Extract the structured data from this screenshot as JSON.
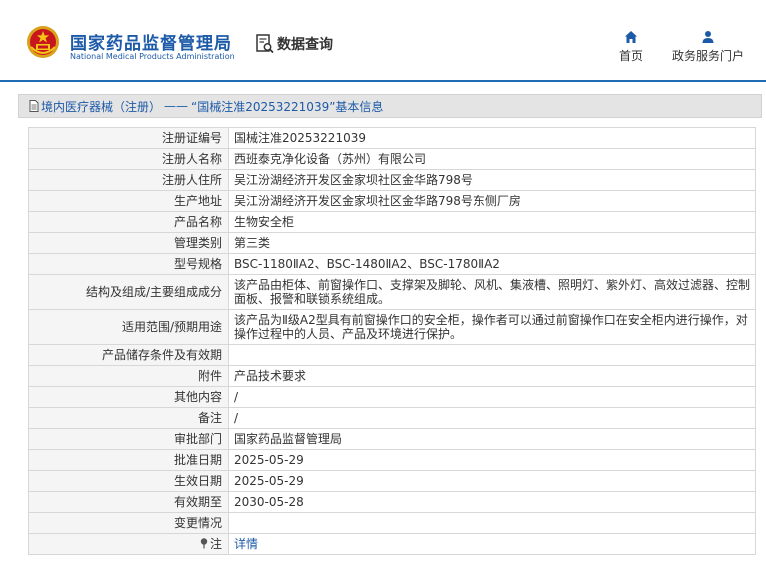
{
  "header": {
    "brand_cn": "国家药品监督管理局",
    "brand_en": "National Medical Products Administration",
    "query_label": "数据查询",
    "nav": [
      {
        "label": "首页",
        "icon": "home-icon"
      },
      {
        "label": "政务服务门户",
        "icon": "person-icon"
      }
    ]
  },
  "breadcrumb": {
    "category": "境内医疗器械（注册）",
    "separator": "——",
    "current": "“国械注准20253221039”基本信息"
  },
  "record": [
    {
      "label": "注册证编号",
      "value": "国械注准20253221039"
    },
    {
      "label": "注册人名称",
      "value": "西班泰克净化设备（苏州）有限公司"
    },
    {
      "label": "注册人住所",
      "value": "吴江汾湖经济开发区金家坝社区金华路798号"
    },
    {
      "label": "生产地址",
      "value": "吴江汾湖经济开发区金家坝社区金华路798号东侧厂房"
    },
    {
      "label": "产品名称",
      "value": "生物安全柜"
    },
    {
      "label": "管理类别",
      "value": "第三类"
    },
    {
      "label": "型号规格",
      "value": "BSC-1180ⅡA2、BSC-1480ⅡA2、BSC-1780ⅡA2"
    },
    {
      "label": "结构及组成/主要组成成分",
      "value": "该产品由柜体、前窗操作口、支撑架及脚轮、风机、集液槽、照明灯、紫外灯、高效过滤器、控制面板、报警和联锁系统组成。"
    },
    {
      "label": "适用范围/预期用途",
      "value": "该产品为Ⅱ级A2型具有前窗操作口的安全柜，操作者可以通过前窗操作口在安全柜内进行操作，对操作过程中的人员、产品及环境进行保护。"
    },
    {
      "label": "产品储存条件及有效期",
      "value": ""
    },
    {
      "label": "附件",
      "value": "产品技术要求"
    },
    {
      "label": "其他内容",
      "value": "/"
    },
    {
      "label": "备注",
      "value": "/"
    },
    {
      "label": "审批部门",
      "value": "国家药品监督管理局"
    },
    {
      "label": "批准日期",
      "value": "2025-05-29"
    },
    {
      "label": "生效日期",
      "value": "2025-05-29"
    },
    {
      "label": "有效期至",
      "value": "2030-05-28"
    },
    {
      "label": "变更情况",
      "value": ""
    }
  ],
  "note": {
    "label": "注",
    "link_text": "详情"
  },
  "colors": {
    "brand": "#1d5aa8",
    "header_rule": "#1f6db3",
    "label_bg": "#f5f5f5",
    "crumb_bg": "#e4e4e4"
  }
}
